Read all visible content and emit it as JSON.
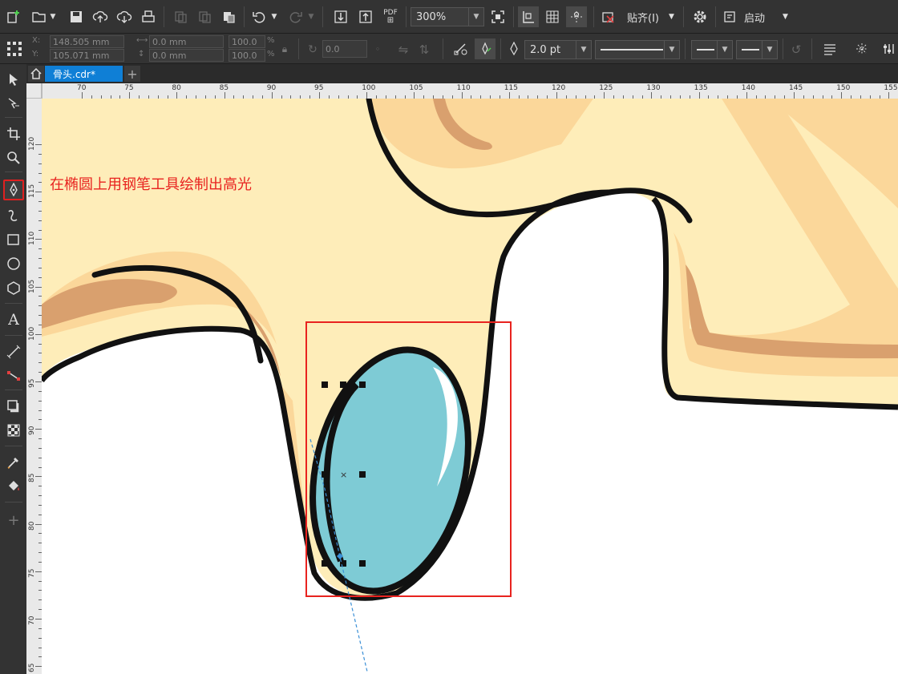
{
  "toolbar": {
    "zoom_value": "300%",
    "snap_label": "贴齐(I)",
    "launch_label": "启动",
    "pdf_label": "PDF"
  },
  "property_bar": {
    "x_label": "X:",
    "y_label": "Y:",
    "x_value": "148.505 mm",
    "y_value": "105.071 mm",
    "width_value": "0.0 mm",
    "height_value": "0.0 mm",
    "scale_w": "100.0",
    "scale_h": "100.0",
    "percent": "%",
    "angle_value": "0.0",
    "outline_width": "2.0 pt"
  },
  "document_tab": {
    "label": "骨头.cdr*"
  },
  "ruler": {
    "h_ticks": [
      "70",
      "75",
      "80",
      "85",
      "90",
      "95",
      "100",
      "105",
      "110",
      "115",
      "120",
      "125",
      "130",
      "135",
      "140",
      "145",
      "150",
      "155"
    ],
    "v_ticks": [
      "120",
      "115",
      "110",
      "105",
      "100",
      "95",
      "90",
      "85",
      "80",
      "75",
      "70",
      "65"
    ]
  },
  "annotation": {
    "text": "在椭圆上用钢笔工具绘制出高光"
  },
  "colors": {
    "accent_red": "#e8231f",
    "tab_blue": "#0f7fd6",
    "bone_fill": "#feedb9",
    "bone_shadow": "#fbd79a",
    "bone_dark": "#d9a06e",
    "ellipse_fill": "#7ecbd5"
  },
  "icons": {
    "new": "new-document-icon",
    "open": "open-folder-icon",
    "save": "save-icon",
    "pen_tool": "pen-tool-icon"
  }
}
